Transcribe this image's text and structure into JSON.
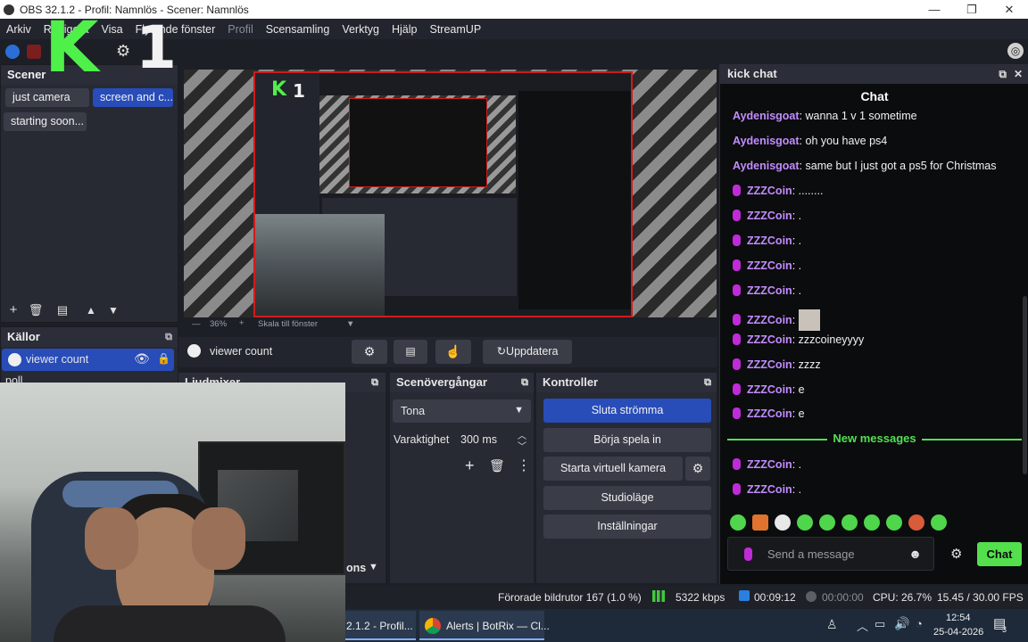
{
  "window": {
    "title": "OBS 32.1.2 - Profil: Namnlös - Scener: Namnlös",
    "minimize": "—",
    "maximize": "❐",
    "close": "✕"
  },
  "menu": [
    "Arkiv",
    "Redigera",
    "Visa",
    "Flytande fönster",
    "Profil",
    "Scensamling",
    "Verktyg",
    "Hjälp",
    "StreamUP"
  ],
  "scenes": {
    "title": "Scener",
    "items": [
      "just camera",
      "screen and c...",
      "starting soon..."
    ],
    "active_index": 1
  },
  "sources": {
    "title": "Källor",
    "items": [
      "viewer count",
      "poll"
    ]
  },
  "preview": {
    "zoom": "36%",
    "scale_label": "Skala till fönster"
  },
  "source_toolbar": {
    "selected_source": "viewer count",
    "refresh_label": "Uppdatera"
  },
  "mixer": {
    "title": "Ljudmixer"
  },
  "transitions": {
    "title": "Scenövergångar",
    "selected": "Tona",
    "duration_label": "Varaktighet",
    "duration_value": "300 ms",
    "menu_label": "ons"
  },
  "controls": {
    "title": "Kontroller",
    "buttons": [
      "Sluta strömma",
      "Börja spela in",
      "Starta virtuell kamera",
      "Studioläge",
      "Inställningar"
    ]
  },
  "status": {
    "dropped_frames": "Förorade bildrutor 167 (1.0 %)",
    "bitrate": "5322 kbps",
    "stream_time": "00:09:12",
    "record_time": "00:00:00",
    "cpu": "CPU: 26.7%",
    "fps": "15.45 / 30.00 FPS"
  },
  "taskbar": {
    "obs_task": "2.1.2 - Profil...",
    "chrome_task": "Alerts | BotRix — Cl...",
    "time": "12:54",
    "date": "25-04-2026",
    "notification_count": "3"
  },
  "kick_chat": {
    "dock_title": "kick chat",
    "header": "Chat",
    "messages": [
      {
        "user": "Aydenisgoat",
        "text": ": wanna 1 v 1 sometime",
        "mic": false
      },
      {
        "user": "Aydenisgoat",
        "text": ": oh you have ps4",
        "mic": false
      },
      {
        "user": "Aydenisgoat",
        "text": ": same but I just got a ps5 for Christmas",
        "mic": false
      },
      {
        "user": "ZZZCoin",
        "text": ": ........",
        "mic": true
      },
      {
        "user": "ZZZCoin",
        "text": ": .",
        "mic": true
      },
      {
        "user": "ZZZCoin",
        "text": ": .",
        "mic": true
      },
      {
        "user": "ZZZCoin",
        "text": ": .",
        "mic": true
      },
      {
        "user": "ZZZCoin",
        "text": ": .",
        "mic": true
      },
      {
        "user": "ZZZCoin",
        "text": ":",
        "mic": true
      },
      {
        "user": "ZZZCoin",
        "text": ": zzzcoineyyyy",
        "mic": true
      },
      {
        "user": "ZZZCoin",
        "text": ": zzzz",
        "mic": true
      },
      {
        "user": "ZZZCoin",
        "text": ": e",
        "mic": true
      },
      {
        "user": "ZZZCoin",
        "text": ": e",
        "mic": true
      }
    ],
    "new_messages_label": "New messages",
    "new_messages": [
      {
        "user": "ZZZCoin",
        "text": ": .",
        "mic": true
      },
      {
        "user": "ZZZCoin",
        "text": ": .",
        "mic": true
      }
    ],
    "input_placeholder": "Send a message",
    "send_label": "Chat"
  },
  "overlay": {
    "logo_letter": "K",
    "logo_number": "1"
  },
  "colors": {
    "accent": "#284cb8",
    "kick_green": "#53e04c",
    "username": "#c28cff"
  }
}
